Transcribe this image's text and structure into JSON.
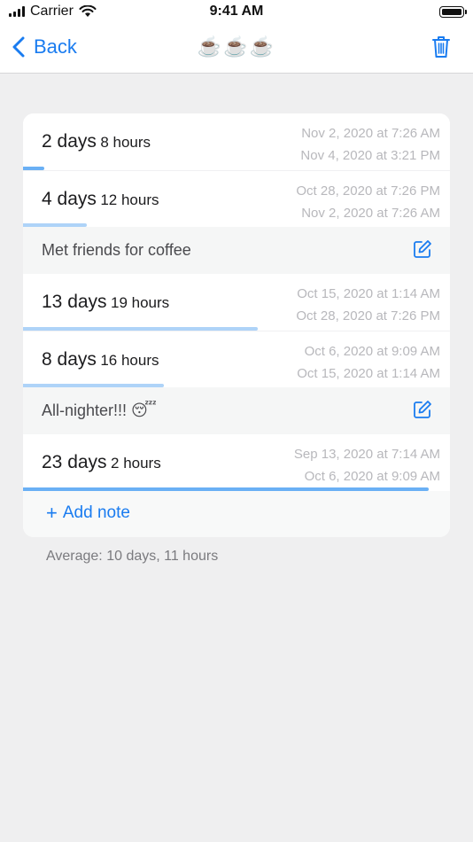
{
  "status_bar": {
    "carrier": "Carrier",
    "time": "9:41 AM"
  },
  "nav": {
    "back_label": "Back",
    "title": "☕️☕️☕️"
  },
  "rows": [
    {
      "type": "interval",
      "days": "2 days",
      "hours": "8 hours",
      "end": "Nov 2, 2020 at 7:26 AM",
      "start": "Nov 4, 2020 at 3:21 PM",
      "bar_fraction": 0.05
    },
    {
      "type": "interval",
      "days": "4 days",
      "hours": "12 hours",
      "end": "Oct 28, 2020 at 7:26 PM",
      "start": "Nov 2, 2020 at 7:26 AM",
      "bar_fraction": 0.15
    },
    {
      "type": "note",
      "text": "Met friends for coffee"
    },
    {
      "type": "interval",
      "days": "13 days",
      "hours": "19 hours",
      "end": "Oct 15, 2020 at 1:14 AM",
      "start": "Oct 28, 2020 at 7:26 PM",
      "bar_fraction": 0.55
    },
    {
      "type": "interval",
      "days": "8 days",
      "hours": "16 hours",
      "end": "Oct 6, 2020 at 9:09 AM",
      "start": "Oct 15, 2020 at 1:14 AM",
      "bar_fraction": 0.33
    },
    {
      "type": "note",
      "text": "All-nighter!!! 😴"
    },
    {
      "type": "interval",
      "days": "23 days",
      "hours": "2 hours",
      "end": "Sep 13, 2020 at 7:14 AM",
      "start": "Oct 6, 2020 at 9:09 AM",
      "bar_fraction": 0.95
    }
  ],
  "add_note_label": "Add note",
  "average_text": "Average: 10 days, 11 hours",
  "colors": {
    "accent": "#1a7cf0",
    "bar_strong": "#6ab0f5",
    "bar_light": "#aed3f8",
    "background": "#efeff0"
  }
}
